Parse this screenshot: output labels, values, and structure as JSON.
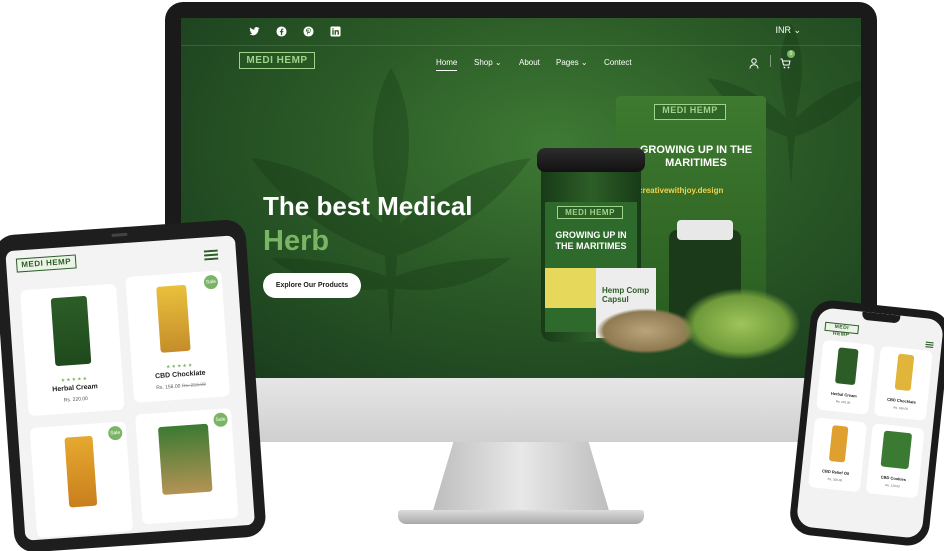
{
  "colors": {
    "brand_green": "#2c5d27",
    "accent_green": "#7ab565",
    "logo_green": "#9fd28a",
    "cta_bg": "#ffffff"
  },
  "desktop": {
    "social_icons": [
      "twitter-icon",
      "facebook-icon",
      "pinterest-icon",
      "linkedin-icon"
    ],
    "currency": "INR",
    "logo": "MEDI HEMP",
    "nav": [
      {
        "label": "Home",
        "active": true
      },
      {
        "label": "Shop",
        "dropdown": true
      },
      {
        "label": "About"
      },
      {
        "label": "Pages",
        "dropdown": true
      },
      {
        "label": "Contect"
      }
    ],
    "cart_count": "0",
    "hero": {
      "title": "The best Medical",
      "highlight": "Herb",
      "cta": "Explore Our Products"
    },
    "packaging": {
      "bag_logo": "MEDI HEMP",
      "bag_text": "GROWING UP IN THE MARITIMES",
      "bag_url": "w.creativewithjoy.design",
      "jar_logo": "MEDI HEMP",
      "jar_text": "GROWING UP IN THE MARITIMES",
      "capsule_text": "Hemp Comp Capsul"
    }
  },
  "tablet": {
    "logo": "MEDI HEMP",
    "products": [
      {
        "name": "Herbal Cream",
        "price": "Rs. 220.00",
        "sale": false
      },
      {
        "name": "CBD Chocklate",
        "price": "Rs. 156.00",
        "old_price": "Rs. 256.00",
        "sale": true,
        "sale_label": "Sale"
      },
      {
        "name": "",
        "price": "",
        "sale": true,
        "sale_label": "Sale"
      },
      {
        "name": "",
        "price": "",
        "sale": true,
        "sale_label": "Sale"
      }
    ]
  },
  "phone": {
    "logo": "MEDI HEMP",
    "products": [
      {
        "name": "Herbal Cream",
        "price": "Rs. 220.00"
      },
      {
        "name": "CBD Chocklate",
        "price": "Rs. 156.00"
      },
      {
        "name": "CBD Relief Oil",
        "price": "Rs. 200.00"
      },
      {
        "name": "CBD Cookies",
        "price": "Rs. 120.00"
      }
    ]
  }
}
